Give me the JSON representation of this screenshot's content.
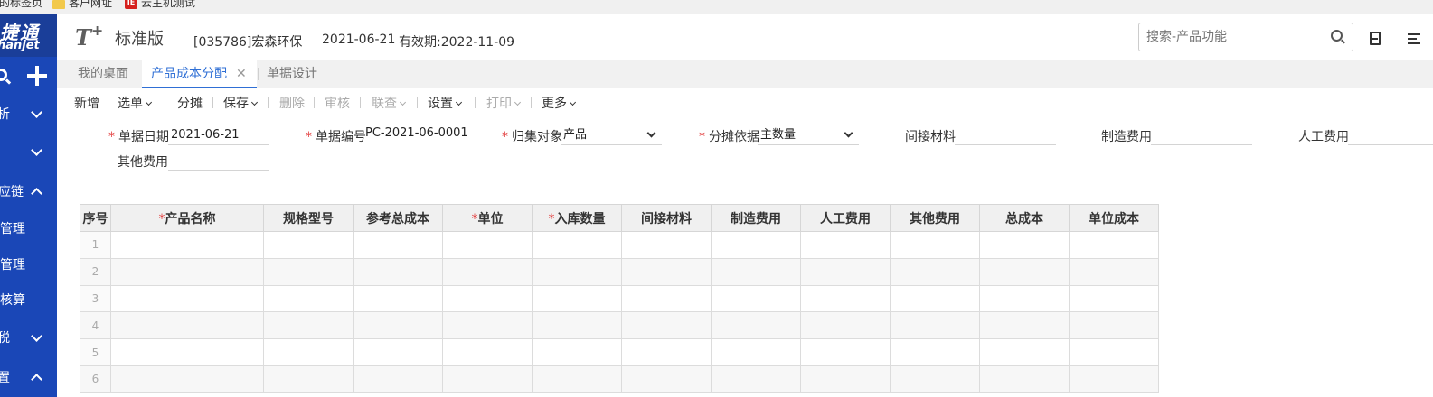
{
  "bookmarks": [
    {
      "label": "的标签页",
      "icon": "none"
    },
    {
      "label": "客户网址",
      "icon": "folder-icon"
    },
    {
      "label": "云主机测试",
      "icon": "app-icon"
    }
  ],
  "bookmark_icon_text": "IE",
  "sidebar": {
    "logo_line1": "捷通",
    "logo_line2": "hanjet",
    "items": [
      {
        "label": "析",
        "chevron": "down"
      },
      {
        "label": "",
        "chevron": "down"
      },
      {
        "label": "应链",
        "chevron": "up"
      },
      {
        "label": "管理",
        "chevron": ""
      },
      {
        "label": "管理",
        "chevron": ""
      },
      {
        "label": "核算",
        "chevron": ""
      },
      {
        "label": "税",
        "chevron": "down"
      },
      {
        "label": "置",
        "chevron": "up"
      }
    ]
  },
  "header": {
    "brand": "T",
    "brand_plus": "+",
    "edition": "标准版",
    "company": "[035786]宏森环保",
    "date": "2021-06-21",
    "validity": "有效期:2022-11-09",
    "search_placeholder": "搜索-产品功能"
  },
  "tabs": [
    {
      "label": "我的桌面",
      "active": false
    },
    {
      "label": "产品成本分配",
      "active": true,
      "close": "✕"
    },
    {
      "label": "单据设计",
      "active": false
    }
  ],
  "toolbar": {
    "items": [
      {
        "label": "新增",
        "enabled": true,
        "dropdown": false
      },
      {
        "label": "选单",
        "enabled": true,
        "dropdown": true
      },
      {
        "label": "分摊",
        "enabled": true,
        "dropdown": false
      },
      {
        "label": "保存",
        "enabled": true,
        "dropdown": true
      },
      {
        "label": "删除",
        "enabled": false,
        "dropdown": false
      },
      {
        "label": "审核",
        "enabled": false,
        "dropdown": false
      },
      {
        "label": "联查",
        "enabled": false,
        "dropdown": true
      },
      {
        "label": "设置",
        "enabled": true,
        "dropdown": true
      },
      {
        "label": "打印",
        "enabled": false,
        "dropdown": true
      },
      {
        "label": "更多",
        "enabled": true,
        "dropdown": true
      }
    ]
  },
  "form": {
    "required_mark": "*",
    "fields": [
      {
        "label": "单据日期",
        "required": true,
        "value": "2021-06-21"
      },
      {
        "label": "单据编号",
        "required": true,
        "value": "PC-2021-06-0001"
      },
      {
        "label": "归集对象",
        "required": true,
        "value": "产品",
        "select": true
      },
      {
        "label": "分摊依据",
        "required": true,
        "value": "主数量",
        "select": true
      },
      {
        "label": "间接材料",
        "required": false,
        "value": ""
      },
      {
        "label": "制造费用",
        "required": false,
        "value": ""
      },
      {
        "label": "人工费用",
        "required": false,
        "value": ""
      },
      {
        "label": "其他费用",
        "required": false,
        "value": ""
      }
    ]
  },
  "grid": {
    "columns": [
      {
        "label": "序号",
        "required": false
      },
      {
        "label": "产品名称",
        "required": true
      },
      {
        "label": "规格型号",
        "required": false
      },
      {
        "label": "参考总成本",
        "required": false
      },
      {
        "label": "单位",
        "required": true
      },
      {
        "label": "入库数量",
        "required": true
      },
      {
        "label": "间接材料",
        "required": false
      },
      {
        "label": "制造费用",
        "required": false
      },
      {
        "label": "人工费用",
        "required": false
      },
      {
        "label": "其他费用",
        "required": false
      },
      {
        "label": "总成本",
        "required": false
      },
      {
        "label": "单位成本",
        "required": false
      }
    ],
    "rows": [
      "1",
      "2",
      "3",
      "4",
      "5",
      "6"
    ]
  },
  "colors": {
    "sidebar": "#1a47b7",
    "accent": "#2f6fd5",
    "required": "#e23b3b"
  }
}
